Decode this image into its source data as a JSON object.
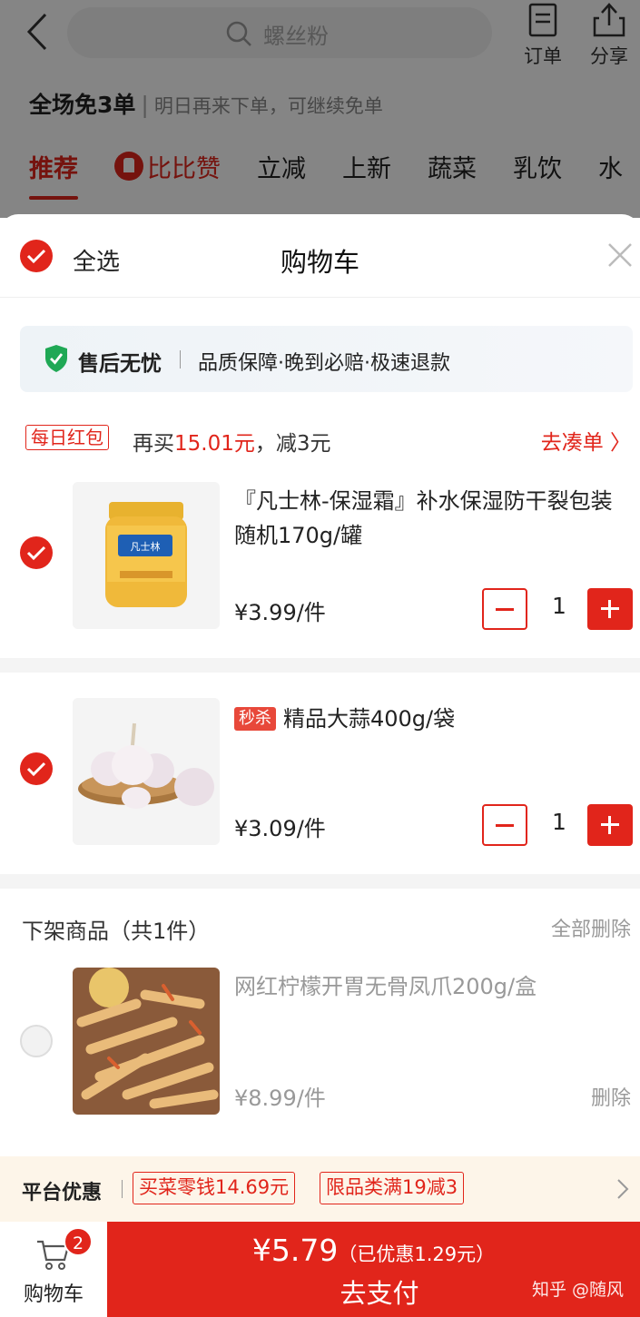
{
  "header": {
    "search_placeholder": "螺丝粉",
    "orders_label": "订单",
    "share_label": "分享"
  },
  "promo": {
    "title": "全场免3单",
    "subtitle": "明日再来下单，可继续免单"
  },
  "category_tabs": [
    {
      "label": "推荐",
      "active": true
    },
    {
      "label": "比比赞",
      "active": false
    },
    {
      "label": "立减",
      "active": false
    },
    {
      "label": "上新",
      "active": false
    },
    {
      "label": "蔬菜",
      "active": false
    },
    {
      "label": "乳饮",
      "active": false
    },
    {
      "label": "水",
      "active": false
    }
  ],
  "cart": {
    "select_all_label": "全选",
    "title": "购物车",
    "guarantee": {
      "title": "售后无忧",
      "text": "品质保障·晚到必赔·极速退款"
    },
    "coupon": {
      "tag": "每日红包",
      "prefix": "再买",
      "amount": "15.01元",
      "suffix": "，减3元",
      "link": "去凑单 〉"
    },
    "items": [
      {
        "name": "『凡士林-保湿霜』补水保湿防干裂包装随机170g/罐",
        "price": "¥3.99/件",
        "quantity": "1",
        "checked": true,
        "thumb_label": "凡士林"
      },
      {
        "badge": "秒杀",
        "name": "精品大蒜400g/袋",
        "price": "¥3.09/件",
        "quantity": "1",
        "checked": true
      }
    ],
    "removed": {
      "heading": "下架商品（共1件）",
      "delete_all": "全部删除",
      "items": [
        {
          "name": "网红柠檬开胃无骨凤爪200g/盒",
          "price": "¥8.99/件",
          "delete": "删除"
        }
      ]
    }
  },
  "platform": {
    "title": "平台优惠",
    "tags": [
      "买菜零钱14.69元",
      "限品类满19减3"
    ]
  },
  "footer": {
    "cart_label": "购物车",
    "cart_count": "2",
    "total": "¥5.79",
    "discount": "（已优惠1.29元）",
    "pay_label": "去支付",
    "watermark": "知乎 @随风"
  },
  "colors": {
    "accent": "#e1251b",
    "guarantee_bg": "#eef3f7",
    "platform_bg": "#fdf5e9"
  }
}
